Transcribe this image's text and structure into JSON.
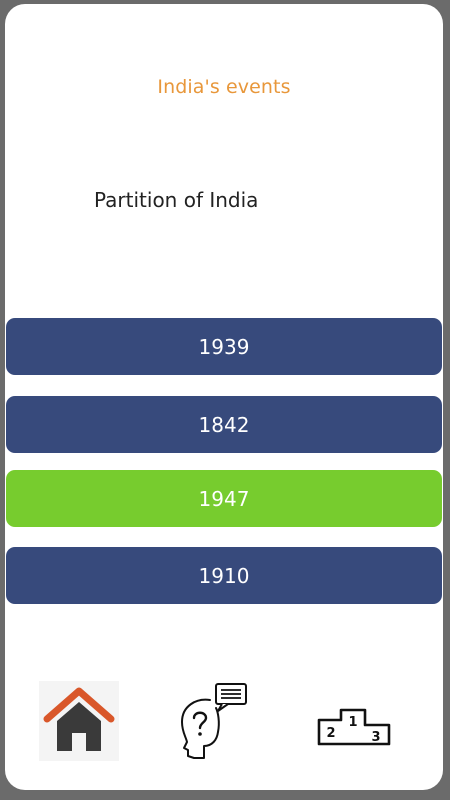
{
  "header": {
    "title": "India's events"
  },
  "question": {
    "text": "Partition of India"
  },
  "answers": [
    {
      "label": "1939",
      "state": "default"
    },
    {
      "label": "1842",
      "state": "default"
    },
    {
      "label": "1947",
      "state": "correct"
    },
    {
      "label": "1910",
      "state": "default"
    }
  ],
  "colors": {
    "title": "#e8973a",
    "answer_default": "#374a7c",
    "answer_correct": "#77cc2e",
    "home_roof": "#d9572a",
    "home_body": "#3a3a3a"
  },
  "nav": {
    "items": [
      {
        "icon": "home-icon"
      },
      {
        "icon": "quiz-thinking-icon"
      },
      {
        "icon": "leaderboard-podium-icon"
      }
    ],
    "podium": {
      "first": "1",
      "second": "2",
      "third": "3"
    }
  }
}
